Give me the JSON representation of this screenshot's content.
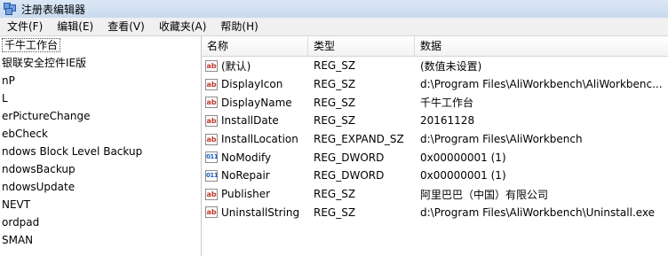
{
  "window": {
    "title": "注册表编辑器"
  },
  "menu": [
    "文件(F)",
    "编辑(E)",
    "查看(V)",
    "收藏夹(A)",
    "帮助(H)"
  ],
  "tree": [
    {
      "label": "千牛工作台",
      "selected": true
    },
    {
      "label": "银联安全控件IE版"
    },
    {
      "label": "nP"
    },
    {
      "label": "L"
    },
    {
      "label": "erPictureChange"
    },
    {
      "label": "ebCheck"
    },
    {
      "label": "ndows Block Level Backup"
    },
    {
      "label": "ndowsBackup"
    },
    {
      "label": "ndowsUpdate"
    },
    {
      "label": "NEVT"
    },
    {
      "label": "ordpad"
    },
    {
      "label": "SMAN"
    }
  ],
  "list": {
    "headers": {
      "name": "名称",
      "type": "类型",
      "data": "数据"
    },
    "rows": [
      {
        "icon": "string-value-icon",
        "name": "(默认)",
        "type": "REG_SZ",
        "data": "(数值未设置)"
      },
      {
        "icon": "string-value-icon",
        "name": "DisplayIcon",
        "type": "REG_SZ",
        "data": "d:\\Program Files\\AliWorkbench\\AliWorkbenc..."
      },
      {
        "icon": "string-value-icon",
        "name": "DisplayName",
        "type": "REG_SZ",
        "data": "千牛工作台"
      },
      {
        "icon": "string-value-icon",
        "name": "InstallDate",
        "type": "REG_SZ",
        "data": "20161128"
      },
      {
        "icon": "string-value-icon",
        "name": "InstallLocation",
        "type": "REG_EXPAND_SZ",
        "data": "d:\\Program Files\\AliWorkbench"
      },
      {
        "icon": "dword-value-icon",
        "name": "NoModify",
        "type": "REG_DWORD",
        "data": "0x00000001 (1)"
      },
      {
        "icon": "dword-value-icon",
        "name": "NoRepair",
        "type": "REG_DWORD",
        "data": "0x00000001 (1)"
      },
      {
        "icon": "string-value-icon",
        "name": "Publisher",
        "type": "REG_SZ",
        "data": "阿里巴巴（中国）有限公司"
      },
      {
        "icon": "string-value-icon",
        "name": "UninstallString",
        "type": "REG_SZ",
        "data": "d:\\Program Files\\AliWorkbench\\Uninstall.exe"
      }
    ]
  }
}
